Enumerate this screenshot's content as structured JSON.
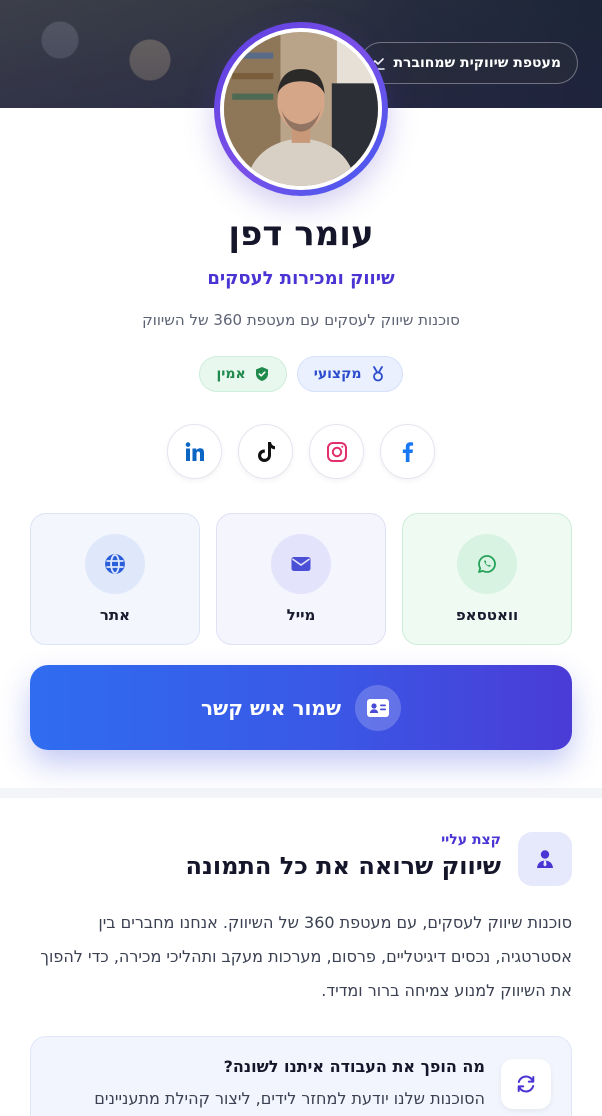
{
  "header": {
    "dashboard_pill": "מעטפת שיווקית שמחוברת"
  },
  "profile": {
    "name": "עומר דפן",
    "title": "שיווק ומכירות לעסקים",
    "description": "סוכנות שיווק לעסקים עם מעטפת 360 של השיווק",
    "badges": [
      {
        "label": "מקצועי",
        "icon": "medal-icon"
      },
      {
        "label": "אמין",
        "icon": "shield-check-icon"
      }
    ]
  },
  "socials": [
    {
      "name": "facebook",
      "icon": "facebook-icon",
      "color": "#1877f2"
    },
    {
      "name": "instagram",
      "icon": "instagram-icon",
      "color": "#e1306c"
    },
    {
      "name": "tiktok",
      "icon": "tiktok-icon",
      "color": "#111111"
    },
    {
      "name": "linkedin",
      "icon": "linkedin-icon",
      "color": "#0a66c2"
    }
  ],
  "actions": [
    {
      "label": "וואטסאפ",
      "icon": "whatsapp-icon",
      "color": "#25a25a"
    },
    {
      "label": "מייל",
      "icon": "mail-icon",
      "color": "#4b4fd6"
    },
    {
      "label": "אתר",
      "icon": "globe-icon",
      "color": "#2b5fd9"
    }
  ],
  "save_contact": {
    "label": "שמור איש קשר",
    "icon": "contact-card-icon"
  },
  "about": {
    "kicker": "קצת עליי",
    "title": "שיווק שרואה את כל התמונה",
    "text": "סוכנות שיווק לעסקים, עם מעטפת 360 של השיווק. אנחנו מחברים בין אסטרטגיה, נכסים דיגיטליים, פרסום, מערכות מעקב ותהליכי מכירה, כדי להפוך את השיווק למנוע צמיחה ברור ומדיד.",
    "info_title": "מה הופך את העבודה איתנו לשונה?",
    "info_text": "הסוכנות שלנו יודעת למחזר לידים, ליצור קהילת מתעניינים"
  },
  "colors": {
    "accent": "#4a35d4",
    "button_start": "#2f6cf0",
    "button_end": "#4a3bd6"
  }
}
